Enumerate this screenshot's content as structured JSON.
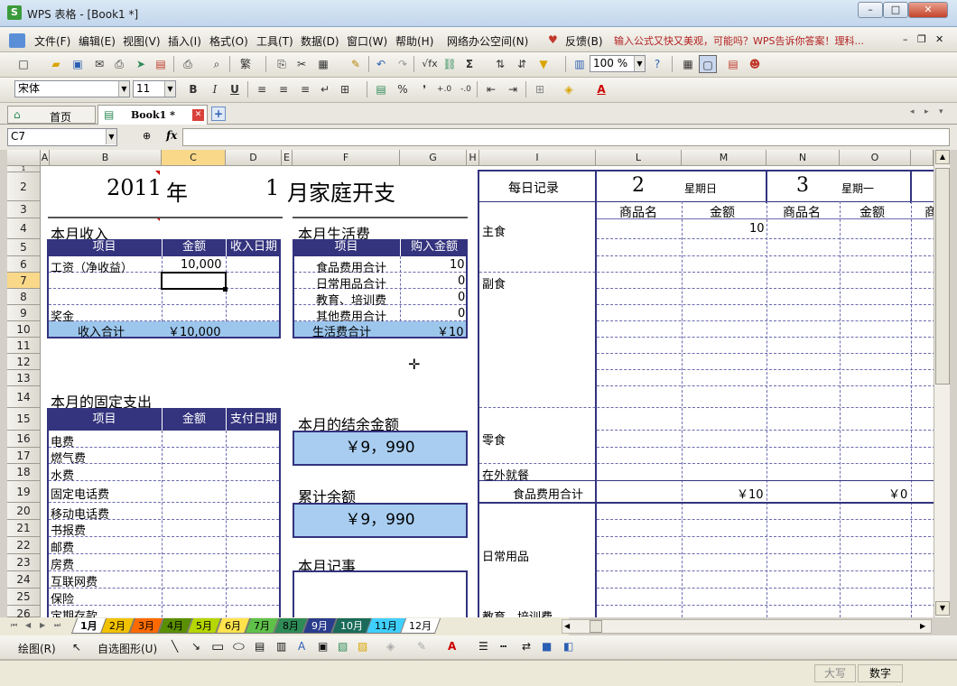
{
  "window": {
    "title": "WPS 表格 - [Book1 *]",
    "app_icon": "S",
    "controls": [
      "–",
      "□",
      "✕"
    ]
  },
  "menu": {
    "items": [
      "文件(F)",
      "编辑(E)",
      "视图(V)",
      "插入(I)",
      "格式(O)",
      "工具(T)",
      "数据(D)",
      "窗口(W)",
      "帮助(H)",
      "网络办公空间(N)",
      "反馈(B)"
    ],
    "tip": "输入公式又快又美观，可能吗？WPS告诉你答案！理科...",
    "doc_controls": [
      "–",
      "❐",
      "✕"
    ]
  },
  "standard_toolbar": {
    "zoom": "100 %"
  },
  "format_toolbar": {
    "font": "宋体",
    "size": "11",
    "bold": "B",
    "italic": "I",
    "underline": "U",
    "percent": "%"
  },
  "doc_tabs": [
    {
      "label": "首页"
    },
    {
      "label": "Book1 *"
    }
  ],
  "formula_bar": {
    "name_box": "C7",
    "fx": "fx"
  },
  "columns": [
    "A",
    "B",
    "C",
    "D",
    "E",
    "F",
    "G",
    "H",
    "I",
    "L",
    "M",
    "N",
    "O"
  ],
  "rows": [
    "1",
    "2",
    "3",
    "4",
    "5",
    "6",
    "7",
    "8",
    "9",
    "10",
    "11",
    "12",
    "13",
    "14",
    "15",
    "16",
    "17",
    "18",
    "19",
    "20",
    "21",
    "22",
    "23",
    "24",
    "25",
    "26"
  ],
  "sheet": {
    "year": "2011",
    "year_suffix": "年",
    "month": "1",
    "title_suffix": "月家庭开支",
    "income": {
      "title": "本月收入",
      "headers": [
        "项目",
        "金额",
        "收入日期"
      ],
      "wage_label": "工资（净收益）",
      "wage_value": "10,000",
      "bonus_label": "奖金",
      "total_label": "收入合计",
      "total_value": "￥10,000"
    },
    "living": {
      "title": "本月生活费",
      "headers": [
        "项目",
        "购入金额"
      ],
      "rows": [
        {
          "label": "食品费用合计",
          "value": "10"
        },
        {
          "label": "日常用品合计",
          "value": "0"
        },
        {
          "label": "教育、培训费",
          "value": "0"
        },
        {
          "label": "其他费用合计",
          "value": "0"
        }
      ],
      "total_label": "生活费合计",
      "total_value": "￥10"
    },
    "fixed": {
      "title": "本月的固定支出",
      "headers": [
        "项目",
        "金额",
        "支付日期"
      ],
      "items": [
        "电费",
        "燃气费",
        "水费",
        "固定电话费",
        "移动电话费",
        "书报费",
        "邮费",
        "房费",
        "互联网费",
        "保险",
        "定期存款"
      ]
    },
    "balance": {
      "title": "本月的结余金额",
      "value": "￥9，990"
    },
    "cumulative": {
      "title": "累计余额",
      "value": "￥9，990"
    },
    "notes": {
      "title": "本月记事"
    },
    "daily": {
      "title": "每日记录",
      "day1": "2",
      "weekday1": "星期日",
      "day2": "3",
      "weekday2": "星期一",
      "col_item": "商品名",
      "col_amount": "金额",
      "col_partial": "商",
      "staple": "主食",
      "staple_amount": "10",
      "side": "副食",
      "snack": "零食",
      "dining": "在外就餐",
      "food_total": "食品费用合计",
      "food_total_m": "￥10",
      "food_total_o": "￥0",
      "daily_goods": "日常用品",
      "edu_partial": "教育、培训费"
    }
  },
  "sheet_tabs": [
    {
      "label": "1月",
      "color": "#ffffff"
    },
    {
      "label": "2月",
      "color": "#f2c200"
    },
    {
      "label": "3月",
      "color": "#ff6a00"
    },
    {
      "label": "4月",
      "color": "#5a8f00"
    },
    {
      "label": "5月",
      "color": "#b5d600"
    },
    {
      "label": "6月",
      "color": "#ffe34d"
    },
    {
      "label": "7月",
      "color": "#5fc14a"
    },
    {
      "label": "8月",
      "color": "#2e8b57"
    },
    {
      "label": "9月",
      "color": "#2a3c8c"
    },
    {
      "label": "10月",
      "color": "#1b6b5a"
    },
    {
      "label": "11月",
      "color": "#40d0ff"
    },
    {
      "label": "12月",
      "color": "#ffffff"
    }
  ],
  "draw_toolbar": {
    "draw": "绘图(R)",
    "autoshape": "自选图形(U)"
  },
  "status": {
    "caps": "大写",
    "num": "数字"
  }
}
